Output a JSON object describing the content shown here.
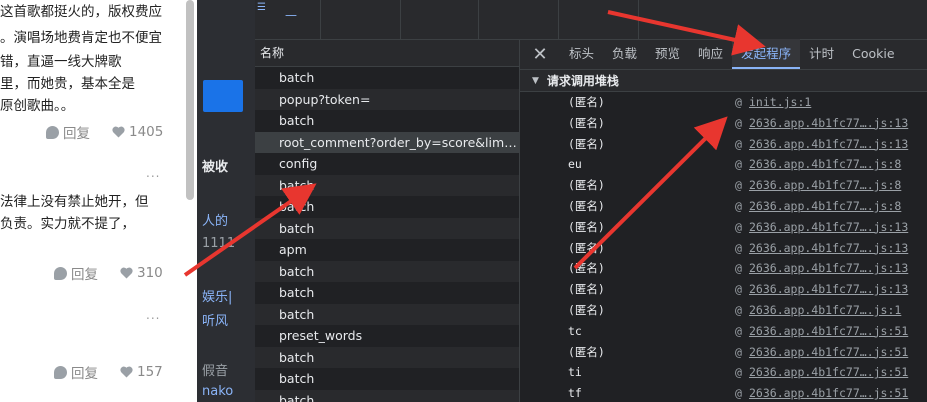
{
  "page": {
    "lines": [
      "这首歌都挺火的，版权费应",
      "。演唱场地费肯定也不便宜",
      "错，直逼一线大牌歌",
      "里，而她贵，基本全是",
      "原创歌曲。。"
    ],
    "comment1": {
      "reply": "回复",
      "likes": "1405"
    },
    "lines2": [
      "法律上没有禁止她开，但",
      "负责。实力就不提了，"
    ],
    "comment2": {
      "reply": "回复",
      "likes": "310"
    },
    "comment3": {
      "reply": "回复",
      "likes": "157"
    },
    "more": "..."
  },
  "middle": {
    "texts": [
      "被收",
      "人的",
      "1111",
      "娱乐|",
      "听风",
      "假音",
      "nako"
    ]
  },
  "devtools": {
    "name_header": "名称",
    "requests": [
      "batch",
      "popup?token=",
      "batch",
      "root_comment?order_by=score&limit...",
      "config",
      "batch",
      "batch",
      "batch",
      "apm",
      "batch",
      "batch",
      "batch",
      "preset_words",
      "batch",
      "batch",
      "batch"
    ],
    "tabs": [
      "标头",
      "负载",
      "预览",
      "响应",
      "发起程序",
      "计时",
      "Cookie"
    ],
    "active_tab": "发起程序",
    "section_title": "请求调用堆栈",
    "stack": [
      {
        "fn": "(匿名)",
        "loc": "init.js:1"
      },
      {
        "fn": "(匿名)",
        "loc": "2636.app.4b1fc77….js:13"
      },
      {
        "fn": "(匿名)",
        "loc": "2636.app.4b1fc77….js:13"
      },
      {
        "fn": "eu",
        "loc": "2636.app.4b1fc77….js:8"
      },
      {
        "fn": "(匿名)",
        "loc": "2636.app.4b1fc77….js:8"
      },
      {
        "fn": "(匿名)",
        "loc": "2636.app.4b1fc77….js:8"
      },
      {
        "fn": "(匿名)",
        "loc": "2636.app.4b1fc77….js:13"
      },
      {
        "fn": "(匿名)",
        "loc": "2636.app.4b1fc77….js:13"
      },
      {
        "fn": "(匿名)",
        "loc": "2636.app.4b1fc77….js:13"
      },
      {
        "fn": "(匿名)",
        "loc": "2636.app.4b1fc77….js:13"
      },
      {
        "fn": "(匿名)",
        "loc": "2636.app.4b1fc77….js:1"
      },
      {
        "fn": "tc",
        "loc": "2636.app.4b1fc77….js:51"
      },
      {
        "fn": "(匿名)",
        "loc": "2636.app.4b1fc77….js:51"
      },
      {
        "fn": "ti",
        "loc": "2636.app.4b1fc77….js:51"
      },
      {
        "fn": "tf",
        "loc": "2636.app.4b1fc77….js:51"
      }
    ],
    "at": "@",
    "close_icon": "close-icon",
    "colors": {
      "accent": "#8ab4f8",
      "arrow": "#e8362f"
    }
  }
}
